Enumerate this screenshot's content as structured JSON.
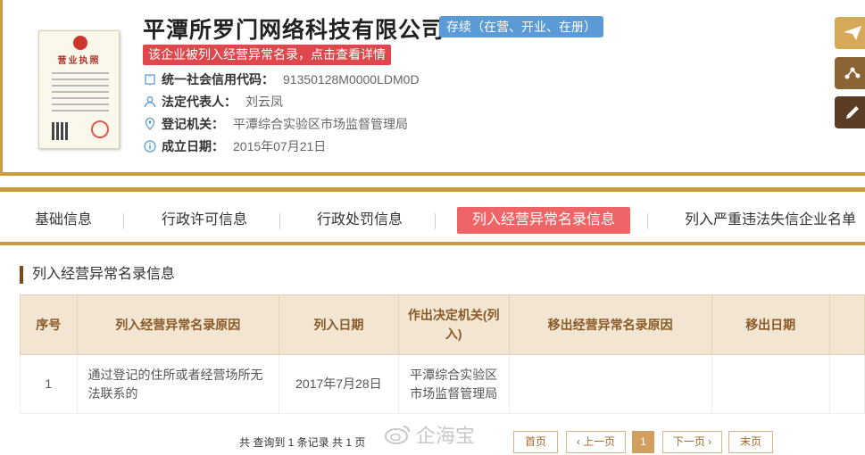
{
  "company": {
    "name": "平潭所罗门网络科技有限公司",
    "status": "存续（在营、开业、在册）",
    "warning": "该企业被列入经营异常名录，点击查看详情",
    "license_title": "营业执照",
    "fields": [
      {
        "label": "统一社会信用代码：",
        "value": "91350128M0000LDM0D"
      },
      {
        "label": "法定代表人：",
        "value": "刘云凤"
      },
      {
        "label": "登记机关：",
        "value": "平潭综合实验区市场监督管理局"
      },
      {
        "label": "成立日期：",
        "value": "2015年07月21日"
      }
    ]
  },
  "side_buttons": [
    "send-icon",
    "share-icon",
    "edit-icon"
  ],
  "tabs": [
    {
      "label": "基础信息"
    },
    {
      "label": "行政许可信息"
    },
    {
      "label": "行政处罚信息"
    },
    {
      "label": "列入经营异常名录信息",
      "active": true
    },
    {
      "label": "列入严重违法失信企业名单（"
    }
  ],
  "section": {
    "title": "列入经营异常名录信息",
    "table": {
      "headers": [
        "序号",
        "列入经营异常名录原因",
        "列入日期",
        "作出决定机关(列入)",
        "移出经营异常名录原因",
        "移出日期"
      ],
      "rows": [
        [
          "1",
          "通过登记的住所或者经营场所无法联系的",
          "2017年7月28日",
          "平潭综合实验区市场监督管理局",
          "",
          ""
        ]
      ]
    }
  },
  "pagination": {
    "summary": "共 查询到 1 条记录 共 1 页",
    "first": "首页",
    "prev": "‹ 上一页",
    "current": "1",
    "next": "下一页 ›",
    "last": "末页"
  },
  "watermark": "企海宝",
  "colors": {
    "accent": "#c99a3e",
    "warning": "#e0474c",
    "status": "#5b9bd5",
    "active_tab": "#ef6466"
  }
}
